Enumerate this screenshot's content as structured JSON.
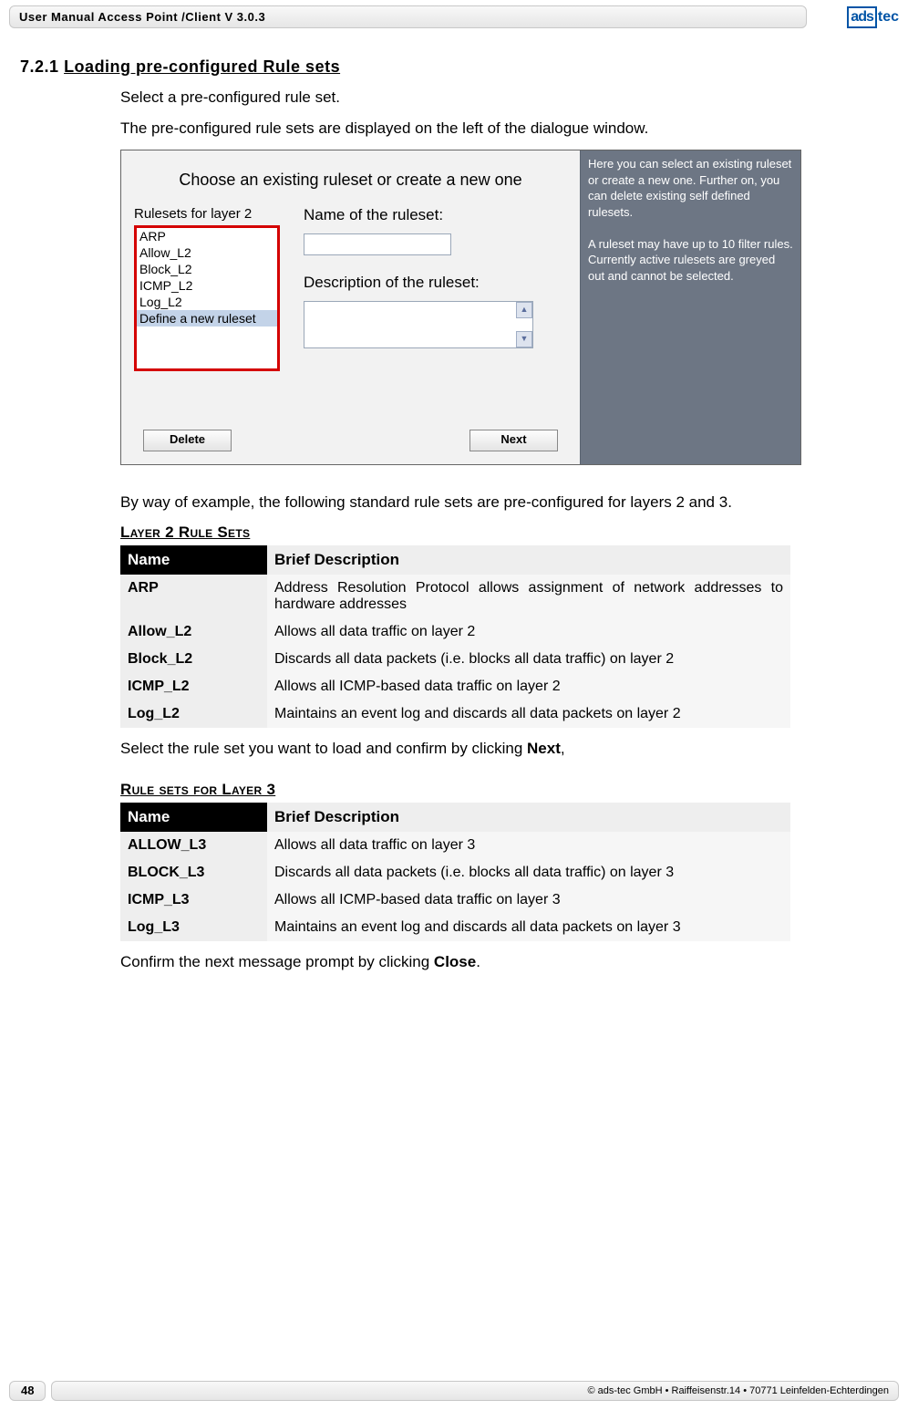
{
  "header": {
    "title": "User Manual Access Point /Client V 3.0.3",
    "logo1": "ads",
    "logo2": "tec"
  },
  "section": {
    "num": "7.2.1",
    "title": "Loading pre-configured Rule sets"
  },
  "intro1": "Select a pre-configured rule set.",
  "intro2": "The pre-configured rule sets are displayed on the left of the dialogue window.",
  "screenshot": {
    "title": "Choose an existing ruleset or create a new one",
    "list_label": "Rulesets for layer 2",
    "list_items": [
      "ARP",
      "Allow_L2",
      "Block_L2",
      "ICMP_L2",
      "Log_L2",
      "Define a new ruleset"
    ],
    "field_name_label": "Name of the ruleset:",
    "field_desc_label": "Description of the ruleset:",
    "btn_delete": "Delete",
    "btn_next": "Next",
    "help1": "Here you can select an existing ruleset or create a new one. Further on, you can delete existing self defined rulesets.",
    "help2": "A ruleset may have up to 10 filter rules. Currently active rulesets are greyed out and cannot be selected."
  },
  "para_example": "By way of example, the following standard rule sets are pre-configured for layers 2 and 3.",
  "table_l2": {
    "caption": "Layer 2 Rule Sets",
    "h_name": "Name",
    "h_desc": "Brief Description",
    "rows": [
      {
        "name": "ARP",
        "desc": "Address Resolution Protocol allows assignment of network addresses to hardware addresses"
      },
      {
        "name": "Allow_L2",
        "desc": "Allows all data traffic on layer 2"
      },
      {
        "name": "Block_L2",
        "desc": "Discards all data packets (i.e. blocks all data traffic) on layer 2"
      },
      {
        "name": "ICMP_L2",
        "desc": "Allows all ICMP-based data traffic on layer 2"
      },
      {
        "name": "Log_L2",
        "desc": "Maintains an event log and discards all data packets on layer 2"
      }
    ]
  },
  "para_select_next_1": "Select the rule set you want to load and confirm by clicking ",
  "para_select_next_bold": "Next",
  "para_select_next_2": ",",
  "table_l3": {
    "caption": "Rule sets for Layer 3",
    "h_name": "Name",
    "h_desc": "Brief Description",
    "rows": [
      {
        "name": "ALLOW_L3",
        "desc": "Allows all data traffic on layer 3"
      },
      {
        "name": "BLOCK_L3",
        "desc": "Discards all data packets (i.e. blocks all data traffic) on layer 3"
      },
      {
        "name": "ICMP_L3",
        "desc": "Allows all ICMP-based data traffic on layer 3"
      },
      {
        "name": "Log_L3",
        "desc": "Maintains an event log and discards all data packets on layer 3"
      }
    ]
  },
  "para_close_1": "Confirm the next message prompt by clicking ",
  "para_close_bold": "Close",
  "para_close_2": ".",
  "footer": {
    "page": "48",
    "copy": "© ads-tec GmbH • Raiffeisenstr.14 • 70771 Leinfelden-Echterdingen"
  }
}
